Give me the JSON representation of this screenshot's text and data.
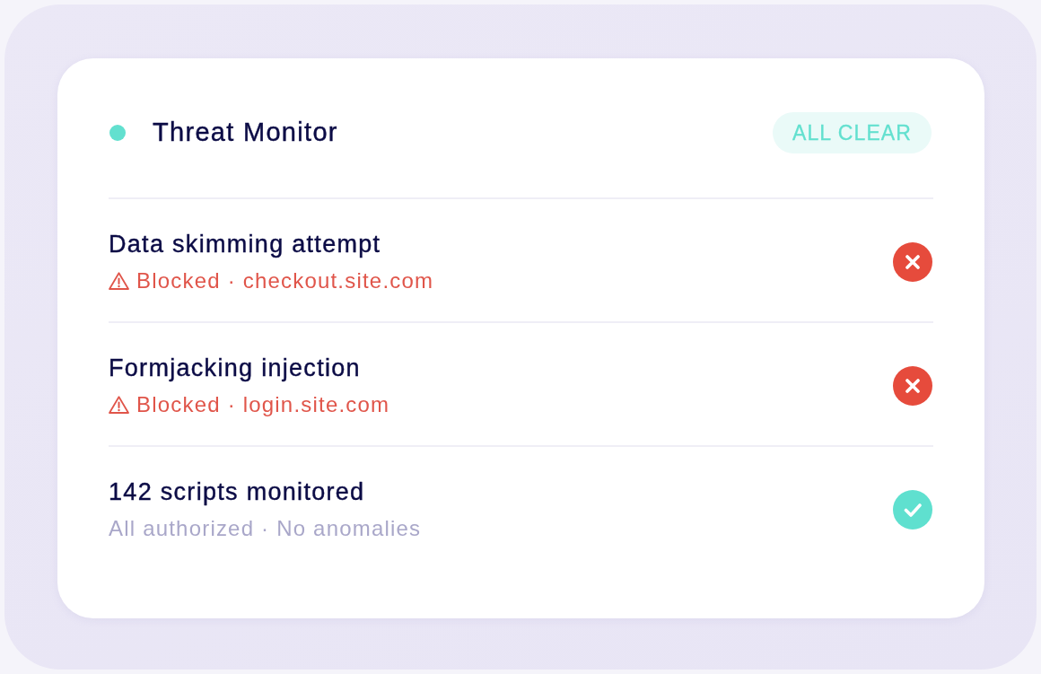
{
  "header": {
    "title": "Threat Monitor",
    "badge": "ALL CLEAR"
  },
  "events": [
    {
      "kind": "blocked",
      "title": "Data skimming attempt",
      "detail": "Blocked · checkout.site.com"
    },
    {
      "kind": "blocked",
      "title": "Formjacking injection",
      "detail": "Blocked · login.site.com"
    },
    {
      "kind": "ok",
      "title": "142 scripts monitored",
      "detail": "All authorized · No anomalies"
    }
  ]
}
